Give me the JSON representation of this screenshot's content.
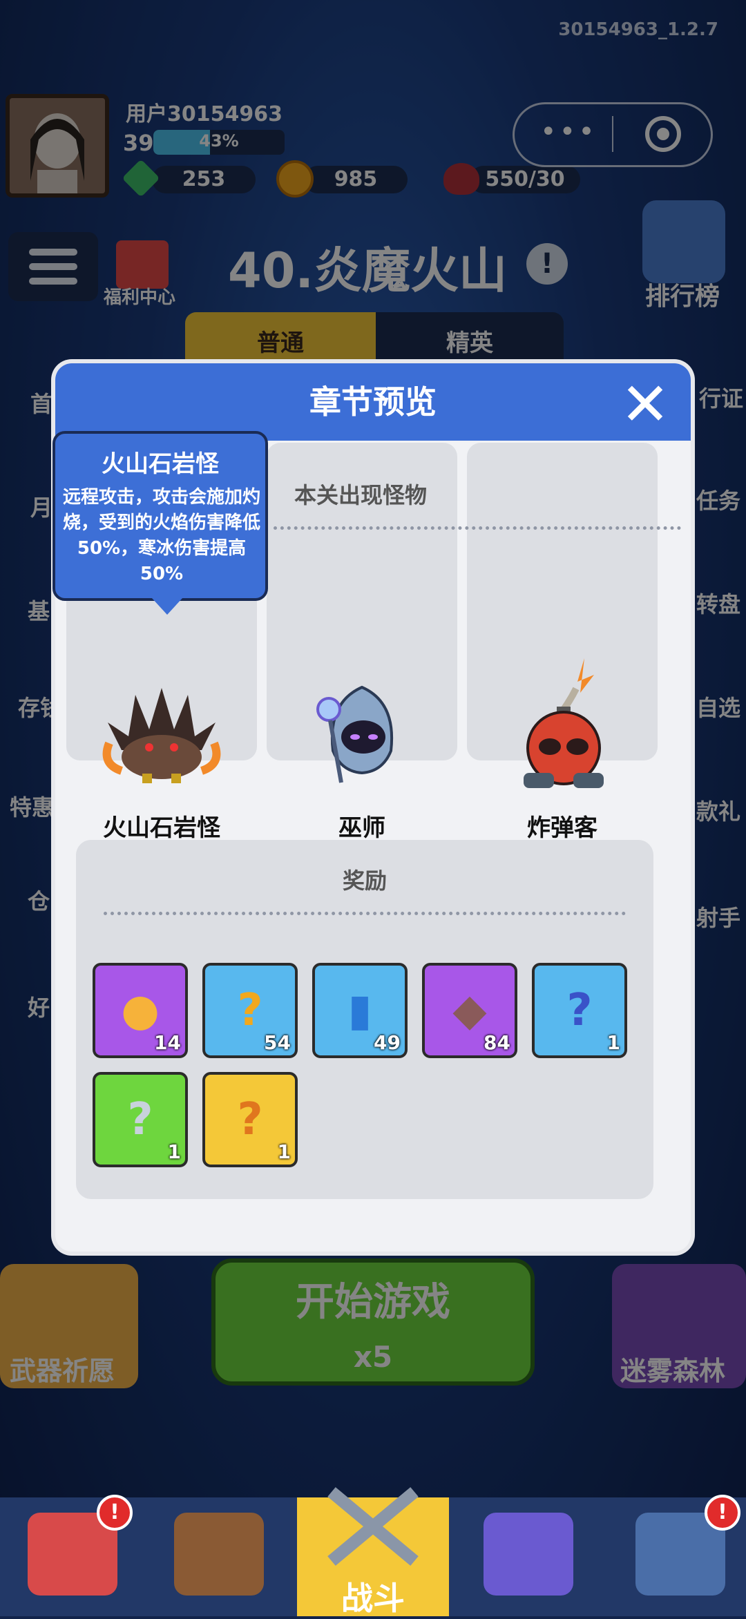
{
  "version": "30154963_1.2.7",
  "profile": {
    "username": "用户30154963",
    "level": "39",
    "xp_percent": "43%",
    "xp_fraction": 0.43
  },
  "resources": {
    "gems": "253",
    "coins": "985",
    "energy": "550/30"
  },
  "welfare_label": "福利中心",
  "chapter_title": "40.炎魔火山",
  "rank_label": "排行榜",
  "tabs": {
    "normal": "普通",
    "elite": "精英"
  },
  "left_side": [
    "首",
    "月",
    "基",
    "存钱",
    "特惠",
    "仓",
    "好"
  ],
  "right_side": [
    "行证",
    "任务",
    "转盘",
    "自选",
    "款礼",
    "射手"
  ],
  "modal": {
    "title": "章节预览",
    "monsters_header": "本关出现怪物",
    "monsters": [
      "火山石岩怪",
      "巫师",
      "炸弹客"
    ],
    "rewards_header": "奖励",
    "rewards": [
      {
        "name": "coin",
        "count": "14",
        "color": "#a857e8"
      },
      {
        "name": "mystery-box",
        "count": "54",
        "color": "#58b8ee"
      },
      {
        "name": "blue-book",
        "count": "49",
        "color": "#58b8ee"
      },
      {
        "name": "ore",
        "count": "84",
        "color": "#a857e8"
      },
      {
        "name": "blue-mystery-card",
        "count": "1",
        "color": "#58b8ee"
      },
      {
        "name": "green-mystery-chest",
        "count": "1",
        "color": "#6ed63e"
      },
      {
        "name": "gold-mystery-gem",
        "count": "1",
        "color": "#f4c838"
      }
    ]
  },
  "tooltip": {
    "title": "火山石岩怪",
    "description": "远程攻击，攻击会施加灼烧，受到的火焰伤害降低50%，寒冰伤害提高50%"
  },
  "start": {
    "label": "开始游戏",
    "cost": "x5"
  },
  "weapon_wish": "武器祈愿",
  "foggy_forest": "迷雾森林",
  "nav": {
    "battle": "战斗",
    "badge": "!"
  }
}
